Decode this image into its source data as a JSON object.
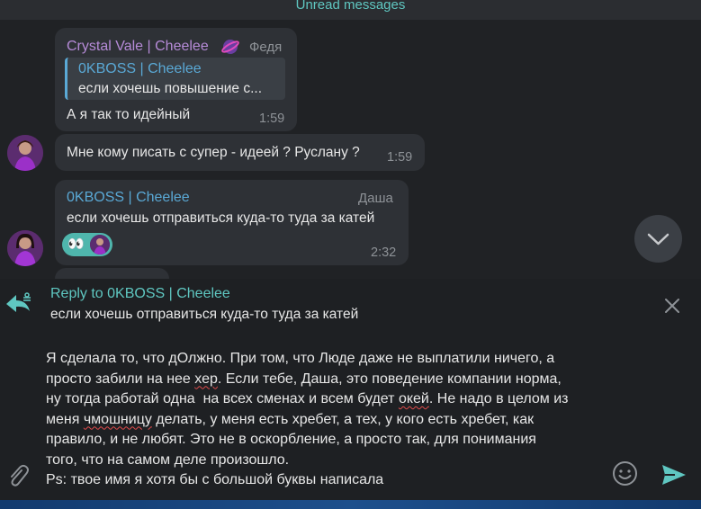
{
  "unread_bar": {
    "label": "Unread messages"
  },
  "messages": [
    {
      "sender": "Crystal Vale | Cheelee",
      "rank": "Федя",
      "quote": {
        "sender": "0KBOSS | Cheelee",
        "text": "если хочешь повышение с..."
      },
      "text": "А я так то идейный",
      "time": "1:59"
    },
    {
      "text": "Мне кому писать с супер - идеей ? Руслану ?",
      "time": "1:59"
    },
    {
      "sender": "0KBOSS | Cheelee",
      "rank": "Даша",
      "text": "если хочешь отправиться куда-то туда за катей",
      "reaction": "👀",
      "time": "2:32"
    }
  ],
  "reply": {
    "label": "Reply to 0KBOSS | Cheelee",
    "text": "если хочешь отправиться куда-то туда за катей"
  },
  "draft": {
    "l1": "Я сделала то, что дОлжно. При том, что Люде даже не выплатили ничего, а",
    "l2a": "просто забили на нее ",
    "l2b": "хер",
    "l2c": ". Если тебе, Даша, это поведение компании норма,",
    "l3a": "ну тогда работай одна  на всех сменах и всем будет ",
    "l3b": "окей",
    "l3c": ". Не надо в целом из",
    "l4a": "меня ",
    "l4b": "чмошницу",
    "l4c": " делать, у меня есть хребет, а тех, у кого есть хребет, как",
    "l5": "правило, и не любят. Это не в оскорбление, а просто так, для понимания",
    "l6": "того, что на самом деле произошло.",
    "l7": "Ps: твое имя я хотя бы с большой буквы написала"
  },
  "colors": {
    "accent": "#5fc7c1",
    "sender_purple": "#b68bd8",
    "sender_blue": "#5aa9d6"
  }
}
